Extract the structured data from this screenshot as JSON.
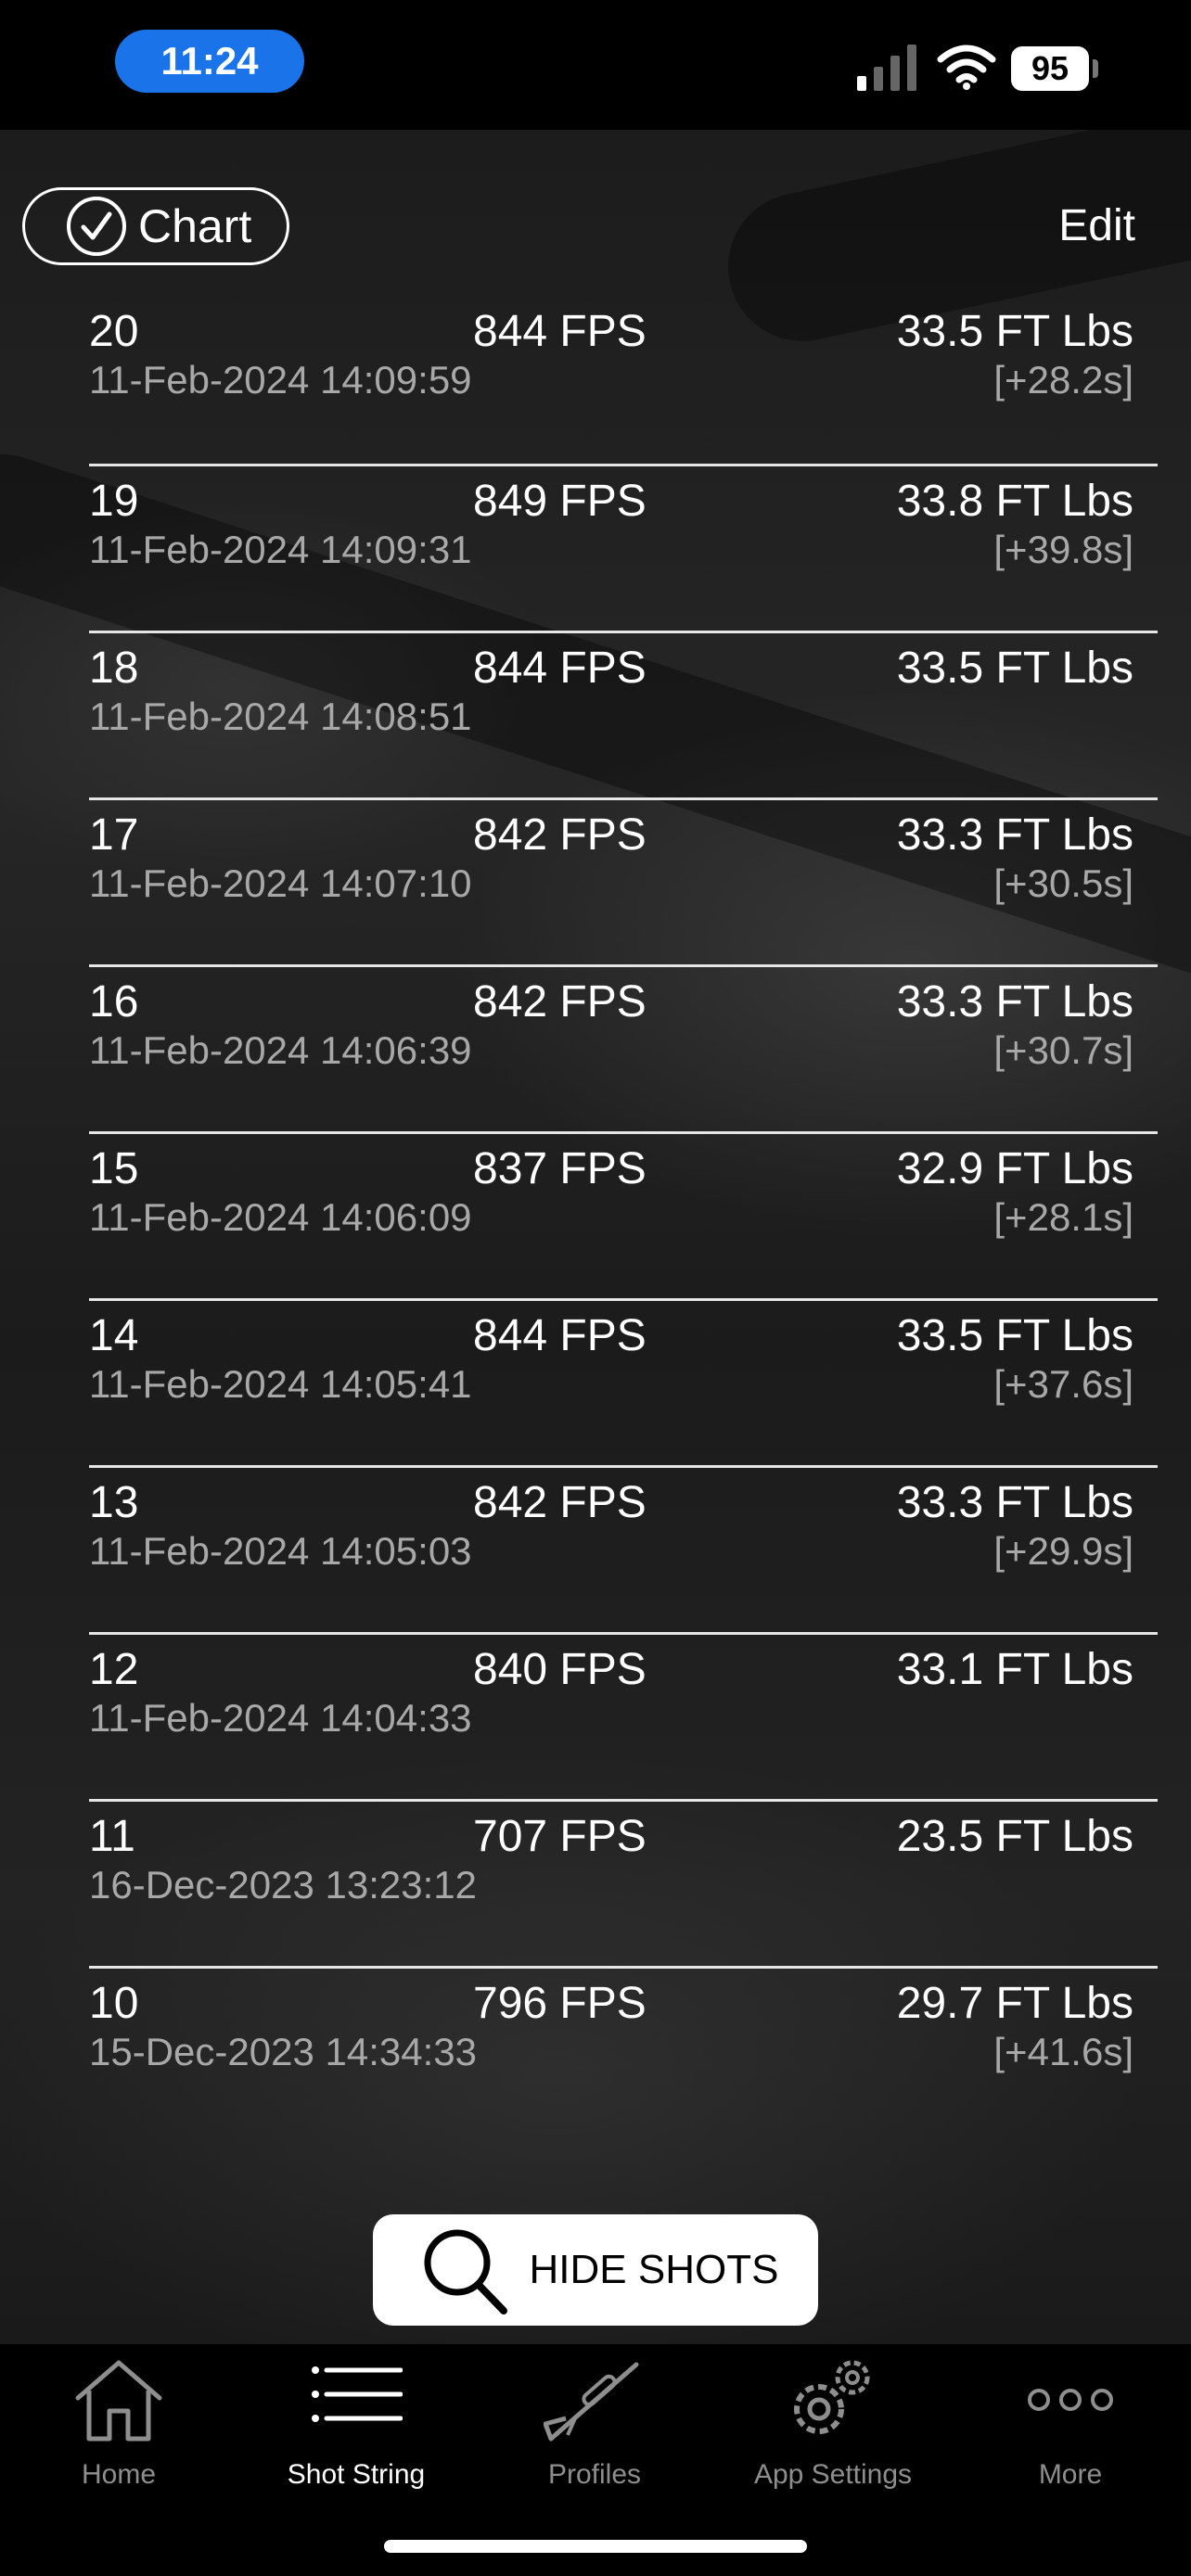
{
  "status_bar": {
    "time": "11:24",
    "battery_level": "95"
  },
  "toolbar": {
    "chart_label": "Chart",
    "edit_label": "Edit"
  },
  "shots": [
    {
      "number": "20",
      "fps": "844 FPS",
      "energy": "33.5 FT Lbs",
      "date": "11-Feb-2024 14:09:59",
      "delta": "[+28.2s]"
    },
    {
      "number": "19",
      "fps": "849 FPS",
      "energy": "33.8 FT Lbs",
      "date": "11-Feb-2024 14:09:31",
      "delta": "[+39.8s]"
    },
    {
      "number": "18",
      "fps": "844 FPS",
      "energy": "33.5 FT Lbs",
      "date": "11-Feb-2024 14:08:51",
      "delta": ""
    },
    {
      "number": "17",
      "fps": "842 FPS",
      "energy": "33.3 FT Lbs",
      "date": "11-Feb-2024 14:07:10",
      "delta": "[+30.5s]"
    },
    {
      "number": "16",
      "fps": "842 FPS",
      "energy": "33.3 FT Lbs",
      "date": "11-Feb-2024 14:06:39",
      "delta": "[+30.7s]"
    },
    {
      "number": "15",
      "fps": "837 FPS",
      "energy": "32.9 FT Lbs",
      "date": "11-Feb-2024 14:06:09",
      "delta": "[+28.1s]"
    },
    {
      "number": "14",
      "fps": "844 FPS",
      "energy": "33.5 FT Lbs",
      "date": "11-Feb-2024 14:05:41",
      "delta": "[+37.6s]"
    },
    {
      "number": "13",
      "fps": "842 FPS",
      "energy": "33.3 FT Lbs",
      "date": "11-Feb-2024 14:05:03",
      "delta": "[+29.9s]"
    },
    {
      "number": "12",
      "fps": "840 FPS",
      "energy": "33.1 FT Lbs",
      "date": "11-Feb-2024 14:04:33",
      "delta": ""
    },
    {
      "number": "11",
      "fps": "707 FPS",
      "energy": "23.5 FT Lbs",
      "date": "16-Dec-2023 13:23:12",
      "delta": ""
    },
    {
      "number": "10",
      "fps": "796 FPS",
      "energy": "29.7 FT Lbs",
      "date": "15-Dec-2023 14:34:33",
      "delta": "[+41.6s]"
    }
  ],
  "hide_shots_label": "HIDE SHOTS",
  "tabs": [
    {
      "label": "Home",
      "icon": "house-icon"
    },
    {
      "label": "Shot String",
      "icon": "list-icon"
    },
    {
      "label": "Profiles",
      "icon": "rifle-icon"
    },
    {
      "label": "App Settings",
      "icon": "gear-icon"
    },
    {
      "label": "More",
      "icon": "more-dots-icon"
    }
  ],
  "active_tab": "Shot String",
  "colors": {
    "time_pill": "#1a73e8",
    "background": "#000000",
    "secondary_text": "#a8a8a8",
    "inactive_tab": "#8e8e8e"
  }
}
